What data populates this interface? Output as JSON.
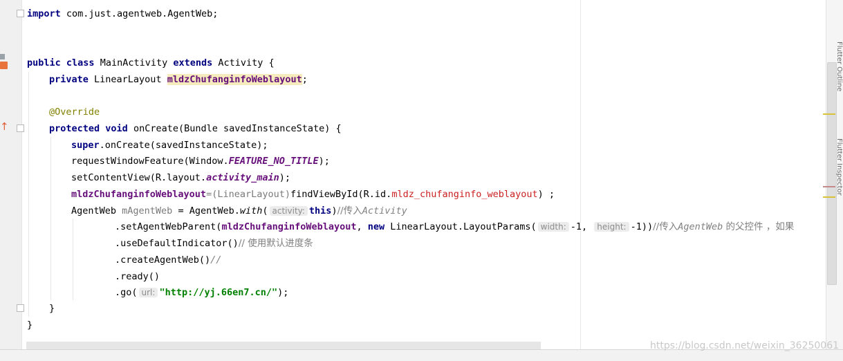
{
  "code": {
    "import_kw": "import",
    "import_path": " com.just.agentweb.AgentWeb;",
    "public_kw": "public",
    "class_kw": "class",
    "class_name": " MainActivity ",
    "extends_kw": "extends",
    "extends_rest": " Activity {",
    "private_kw": "private",
    "field_type": " LinearLayout ",
    "field_name": "mldzChufanginfoWeblayout",
    "semicolon": ";",
    "override": "@Override",
    "protected_kw": "protected",
    "void_kw": "void",
    "oncreate_sig": " onCreate(Bundle savedInstanceState) {",
    "super_kw": "super",
    "super_call": ".onCreate(savedInstanceState);",
    "rwf_pre": "requestWindowFeature(Window.",
    "rwf_const": "FEATURE_NO_TITLE",
    "rwf_post": ");",
    "scv_pre": "setContentView(R.layout.",
    "scv_const": "activity_main",
    "scv_post": ");",
    "fvb_field": "mldzChufanginfoWeblayout",
    "fvb_cast": "=(LinearLayout)",
    "fvb_call": "findViewById(R.id.",
    "fvb_id": "mldz_chufanginfo_weblayout",
    "fvb_end": ") ;",
    "aw_type": "AgentWeb ",
    "aw_var": "mAgentWeb",
    "aw_eq": " = AgentWeb.",
    "aw_with": "with",
    "aw_paren": "(",
    "hint_activity": "activity:",
    "this_kw": "this",
    "aw_close": ")",
    "cmt1_a": "//传入",
    "cmt1_b": "Activity",
    "sawp_pre": ".setAgentWebParent(",
    "sawp_field": "mldzChufanginfoWeblayout",
    "sawp_comma": ", ",
    "new_kw": "new",
    "sawp_lp": " LinearLayout.LayoutParams(",
    "hint_width": "width:",
    "width_val": "-1,",
    "hint_height": "height:",
    "height_val": "-1))",
    "cmt2_a": "//传入",
    "cmt2_b": "AgentWeb",
    "cmt2_c": " 的父控件 ，如果",
    "udi": ".useDefaultIndicator()",
    "cmt3": "// 使用默认进度条",
    "caw": ".createAgentWeb()",
    "cmt4": "//",
    "ready": ".ready()",
    "go_pre": ".go(",
    "hint_url": "url:",
    "url_str": "\"http://yj.66en7.cn/\"",
    "go_post": ");",
    "close_method": "}",
    "close_class": "}"
  },
  "side_tabs": {
    "outline": "Flutter Outline",
    "inspector": "Flutter Inspector"
  },
  "watermark": "https://blog.csdn.net/weixin_36250061"
}
